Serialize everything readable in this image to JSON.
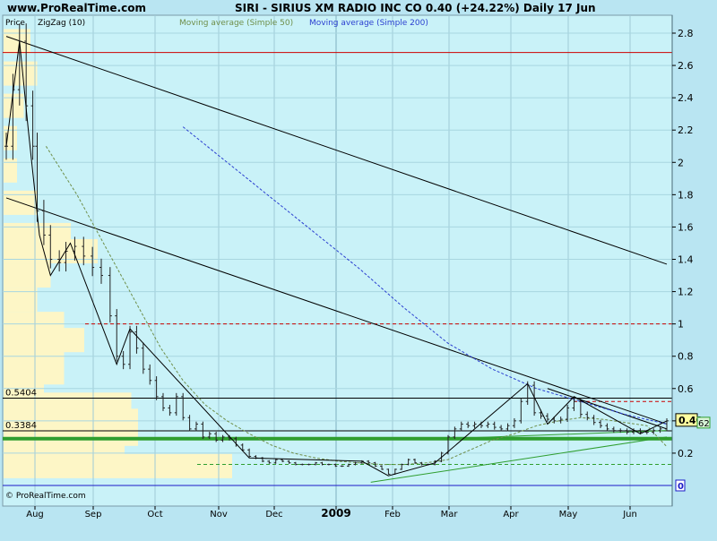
{
  "header": {
    "site": "www.ProRealTime.com",
    "title": "SIRI - SIRIUS XM RADIO INC CO   0.40 (+24.22%)   Daily  17 Jun"
  },
  "legend": {
    "price_label": "Price",
    "zigzag_label": "ZigZag (10)",
    "ma50_label": "Moving average (Simple 50)",
    "ma200_label": "Moving average (Simple 200)"
  },
  "footer": {
    "copyright": "© ProRealTime.com"
  },
  "colors": {
    "plot_bg": "#c9f2f8",
    "outer_bg": "#b9e5f2",
    "candle": "#222222",
    "ma50": "#6f8f4a",
    "ma200": "#2b3fd0",
    "volume_profile": "#fdf6c6",
    "support": "#2f9e2f",
    "resistance": "#cc0000",
    "zero_line": "#1b1bc8"
  },
  "chart_data": {
    "type": "candlestick",
    "symbol": "SIRI",
    "name": "SIRIUS XM RADIO INC CO",
    "last": "0.40",
    "change_pct": "+24.22%",
    "y_ticks": [
      0.2,
      0.4,
      0.6,
      0.8,
      1,
      1.2,
      1.4,
      1.6,
      1.8,
      2,
      2.2,
      2.4,
      2.6,
      2.8
    ],
    "ylim": [
      -0.05,
      2.88
    ],
    "x_ticks": [
      "Aug",
      "Sep",
      "Oct",
      "Nov",
      "Dec",
      "2009",
      "Feb",
      "Mar",
      "Apr",
      "May",
      "Jun"
    ],
    "current_price_label": "0.40",
    "partial_price_label": "62",
    "zero_label": "0",
    "level_labels": [
      {
        "label": "0.5404",
        "value": 0.5404
      },
      {
        "label": "0.3384",
        "value": 0.3384
      }
    ],
    "horizontal_lines": [
      {
        "value": 2.68,
        "style": "solid",
        "color": "#cc0000"
      },
      {
        "value": 1.0,
        "style": "dashed",
        "color": "#cc0000"
      },
      {
        "value": 0.5404,
        "style": "solid",
        "color": "#000000"
      },
      {
        "value": 0.52,
        "style": "dashed",
        "color": "#cc0000"
      },
      {
        "value": 0.3384,
        "style": "solid",
        "color": "#000000"
      },
      {
        "value": 0.29,
        "style": "thick",
        "color": "#2f9e2f"
      },
      {
        "value": 0.13,
        "style": "dashed",
        "color": "#2f9e2f"
      },
      {
        "value": 0.0,
        "style": "solid",
        "color": "#1b1bc8"
      }
    ],
    "price_series": [
      [
        0,
        2.1
      ],
      [
        3,
        2.45
      ],
      [
        6,
        2.75
      ],
      [
        9,
        2.35
      ],
      [
        12,
        2.1
      ],
      [
        14,
        1.7
      ],
      [
        17,
        1.55
      ],
      [
        20,
        1.4
      ],
      [
        24,
        1.38
      ],
      [
        27,
        1.45
      ],
      [
        31,
        1.48
      ],
      [
        35,
        1.42
      ],
      [
        39,
        1.35
      ],
      [
        43,
        1.3
      ],
      [
        47,
        1.05
      ],
      [
        50,
        0.8
      ],
      [
        53,
        0.75
      ],
      [
        56,
        0.95
      ],
      [
        59,
        0.85
      ],
      [
        62,
        0.72
      ],
      [
        65,
        0.65
      ],
      [
        68,
        0.55
      ],
      [
        71,
        0.48
      ],
      [
        74,
        0.45
      ],
      [
        77,
        0.55
      ],
      [
        80,
        0.42
      ],
      [
        83,
        0.35
      ],
      [
        86,
        0.38
      ],
      [
        89,
        0.3
      ],
      [
        92,
        0.32
      ],
      [
        95,
        0.28
      ],
      [
        98,
        0.3
      ],
      [
        101,
        0.29
      ],
      [
        104,
        0.25
      ],
      [
        107,
        0.22
      ],
      [
        110,
        0.18
      ],
      [
        113,
        0.17
      ],
      [
        116,
        0.15
      ],
      [
        119,
        0.14
      ],
      [
        122,
        0.16
      ],
      [
        125,
        0.15
      ],
      [
        128,
        0.14
      ],
      [
        131,
        0.13
      ],
      [
        134,
        0.13
      ],
      [
        137,
        0.13
      ],
      [
        140,
        0.14
      ],
      [
        143,
        0.13
      ],
      [
        146,
        0.13
      ],
      [
        149,
        0.12
      ],
      [
        152,
        0.12
      ],
      [
        155,
        0.13
      ],
      [
        158,
        0.14
      ],
      [
        161,
        0.15
      ],
      [
        164,
        0.14
      ],
      [
        167,
        0.12
      ],
      [
        170,
        0.1
      ],
      [
        173,
        0.07
      ],
      [
        176,
        0.1
      ],
      [
        179,
        0.13
      ],
      [
        182,
        0.16
      ],
      [
        185,
        0.14
      ],
      [
        188,
        0.13
      ],
      [
        191,
        0.13
      ],
      [
        194,
        0.15
      ],
      [
        197,
        0.2
      ],
      [
        200,
        0.3
      ],
      [
        203,
        0.35
      ],
      [
        206,
        0.38
      ],
      [
        209,
        0.37
      ],
      [
        212,
        0.38
      ],
      [
        215,
        0.37
      ],
      [
        218,
        0.38
      ],
      [
        221,
        0.36
      ],
      [
        224,
        0.35
      ],
      [
        227,
        0.37
      ],
      [
        230,
        0.4
      ],
      [
        233,
        0.52
      ],
      [
        236,
        0.62
      ],
      [
        239,
        0.45
      ],
      [
        242,
        0.43
      ],
      [
        245,
        0.41
      ],
      [
        248,
        0.4
      ],
      [
        251,
        0.41
      ],
      [
        254,
        0.48
      ],
      [
        257,
        0.52
      ],
      [
        260,
        0.44
      ],
      [
        263,
        0.42
      ],
      [
        266,
        0.39
      ],
      [
        269,
        0.37
      ],
      [
        272,
        0.35
      ],
      [
        275,
        0.34
      ],
      [
        278,
        0.34
      ],
      [
        281,
        0.33
      ],
      [
        284,
        0.34
      ],
      [
        287,
        0.33
      ],
      [
        290,
        0.33
      ],
      [
        293,
        0.34
      ],
      [
        296,
        0.35
      ],
      [
        299,
        0.4
      ]
    ],
    "zigzag": [
      [
        0,
        2.1
      ],
      [
        6,
        2.75
      ],
      [
        10,
        2.2
      ],
      [
        15,
        1.55
      ],
      [
        20,
        1.3
      ],
      [
        29,
        1.5
      ],
      [
        50,
        0.75
      ],
      [
        56,
        0.97
      ],
      [
        110,
        0.17
      ],
      [
        161,
        0.15
      ],
      [
        173,
        0.06
      ],
      [
        194,
        0.14
      ],
      [
        236,
        0.63
      ],
      [
        245,
        0.38
      ],
      [
        257,
        0.55
      ],
      [
        287,
        0.32
      ],
      [
        299,
        0.4
      ]
    ],
    "ma50": [
      [
        18,
        2.1
      ],
      [
        25,
        1.95
      ],
      [
        32,
        1.8
      ],
      [
        40,
        1.6
      ],
      [
        50,
        1.35
      ],
      [
        60,
        1.1
      ],
      [
        70,
        0.85
      ],
      [
        80,
        0.65
      ],
      [
        90,
        0.5
      ],
      [
        100,
        0.4
      ],
      [
        110,
        0.32
      ],
      [
        120,
        0.25
      ],
      [
        130,
        0.2
      ],
      [
        140,
        0.17
      ],
      [
        150,
        0.15
      ],
      [
        160,
        0.14
      ],
      [
        170,
        0.13
      ],
      [
        180,
        0.13
      ],
      [
        190,
        0.14
      ],
      [
        200,
        0.16
      ],
      [
        210,
        0.22
      ],
      [
        220,
        0.28
      ],
      [
        230,
        0.32
      ],
      [
        240,
        0.37
      ],
      [
        250,
        0.4
      ],
      [
        260,
        0.42
      ],
      [
        270,
        0.41
      ],
      [
        280,
        0.39
      ],
      [
        290,
        0.37
      ],
      [
        299,
        0.24
      ]
    ],
    "ma200": [
      [
        80,
        2.22
      ],
      [
        100,
        2.0
      ],
      [
        120,
        1.78
      ],
      [
        140,
        1.56
      ],
      [
        160,
        1.34
      ],
      [
        180,
        1.1
      ],
      [
        200,
        0.88
      ],
      [
        220,
        0.72
      ],
      [
        240,
        0.6
      ],
      [
        260,
        0.52
      ],
      [
        280,
        0.44
      ],
      [
        299,
        0.38
      ]
    ],
    "trendlines": [
      [
        [
          0,
          2.78
        ],
        [
          299,
          1.37
        ]
      ],
      [
        [
          0,
          1.78
        ],
        [
          299,
          0.38
        ]
      ],
      [
        [
          165,
          0.02
        ],
        [
          299,
          0.3
        ]
      ],
      [
        [
          245,
          0.6
        ],
        [
          299,
          0.35
        ]
      ],
      [
        [
          200,
          0.29
        ],
        [
          299,
          0.34
        ]
      ]
    ],
    "volume_profile": [
      {
        "value": 2.75,
        "width": 0.04
      },
      {
        "value": 2.55,
        "width": 0.05
      },
      {
        "value": 2.35,
        "width": 0.03
      },
      {
        "value": 2.15,
        "width": 0.02
      },
      {
        "value": 1.95,
        "width": 0.02
      },
      {
        "value": 1.75,
        "width": 0.05
      },
      {
        "value": 1.55,
        "width": 0.1
      },
      {
        "value": 1.45,
        "width": 0.14
      },
      {
        "value": 1.3,
        "width": 0.07
      },
      {
        "value": 1.15,
        "width": 0.05
      },
      {
        "value": 1.0,
        "width": 0.09
      },
      {
        "value": 0.9,
        "width": 0.12
      },
      {
        "value": 0.8,
        "width": 0.09
      },
      {
        "value": 0.7,
        "width": 0.09
      },
      {
        "value": 0.6,
        "width": 0.06
      },
      {
        "value": 0.5,
        "width": 0.19
      },
      {
        "value": 0.4,
        "width": 0.2
      },
      {
        "value": 0.32,
        "width": 0.2
      },
      {
        "value": 0.22,
        "width": 0.18
      },
      {
        "value": 0.12,
        "width": 0.34
      }
    ]
  }
}
